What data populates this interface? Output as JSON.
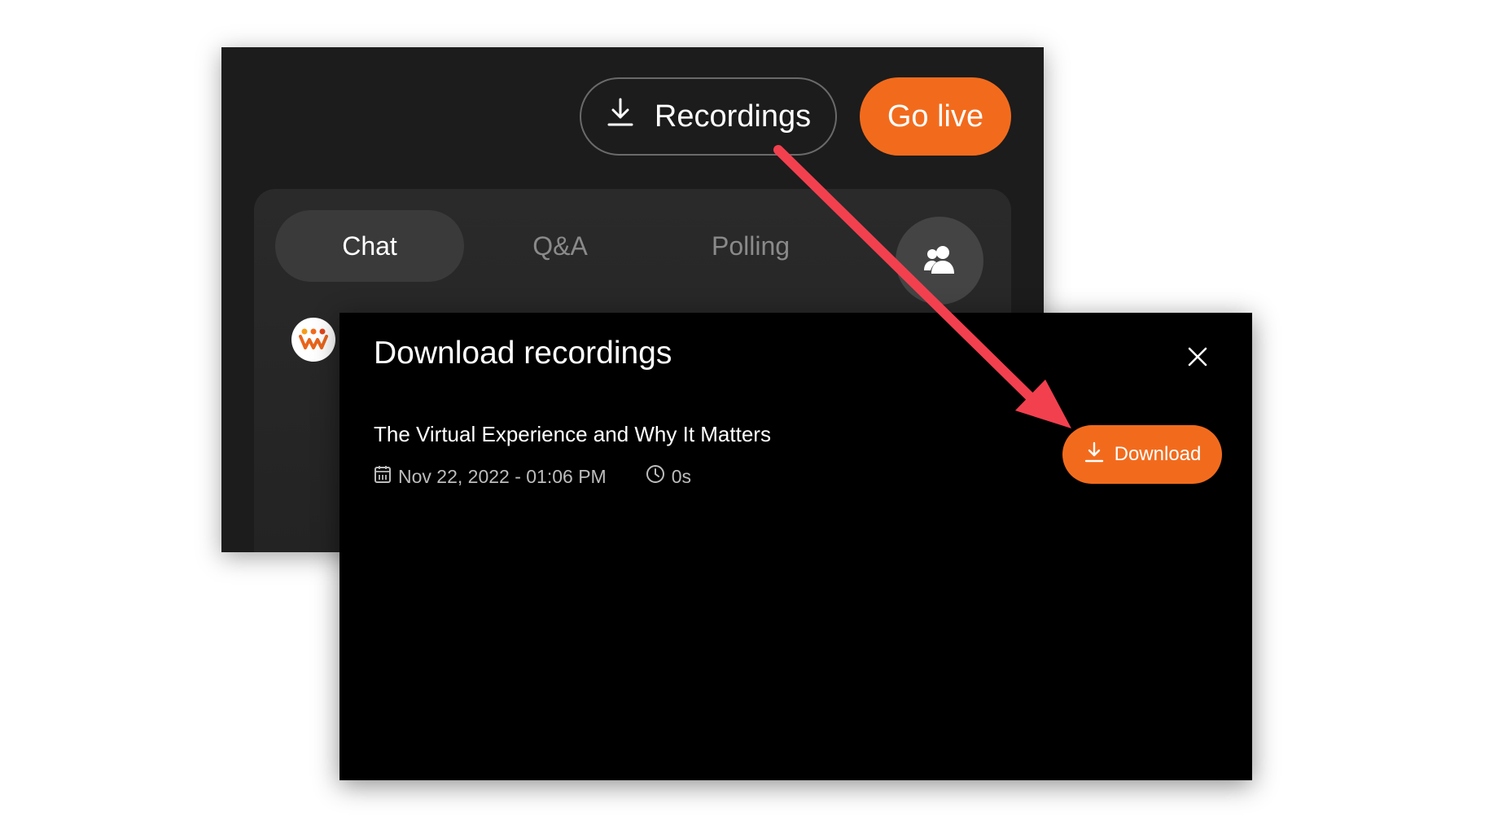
{
  "header": {
    "recordings_label": "Recordings",
    "go_live_label": "Go live"
  },
  "tabs": [
    {
      "label": "Chat",
      "active": true
    },
    {
      "label": "Q&A",
      "active": false
    },
    {
      "label": "Polling",
      "active": false
    }
  ],
  "modal": {
    "title": "Download recordings",
    "recording": {
      "title": "The Virtual Experience and Why It Matters",
      "date": "Nov 22, 2022 - 01:06 PM",
      "duration": "0s"
    },
    "download_label": "Download"
  },
  "icons": {
    "recordings": "download-icon",
    "people": "people-icon",
    "close": "close-icon",
    "calendar": "calendar-icon",
    "clock": "clock-icon",
    "download": "download-icon",
    "avatar": "app-logo-icon"
  },
  "colors": {
    "accent": "#f26b1d",
    "annotation_arrow": "#f2404f",
    "panel_bg": "#1c1c1c",
    "modal_bg": "#000000"
  }
}
